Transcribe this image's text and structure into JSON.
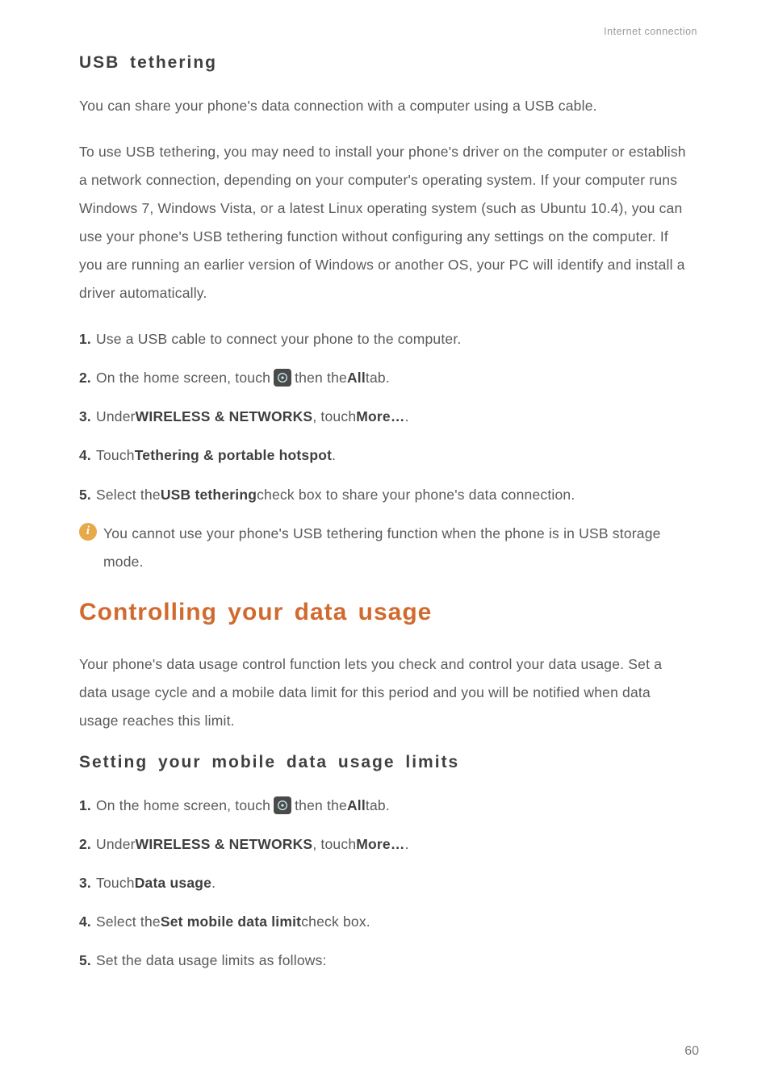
{
  "header": {
    "section_label": "Internet connection"
  },
  "usb_tethering": {
    "title": "USB tethering",
    "intro": "You can share your phone's data connection with a computer using a USB cable.",
    "note": "To use USB tethering, you may need to install your phone's driver on the computer or establish a network connection, depending on your computer's operating system. If your computer runs Windows 7, Windows Vista, or a latest Linux operating system (such as Ubuntu 10.4), you can use your phone's USB tethering function without configuring any settings on the computer. If you are running an earlier version of Windows or another OS, your PC will identify and install a driver automatically.",
    "steps": {
      "s1": {
        "num": "1.",
        "text": "Use a USB cable to connect your phone to the computer."
      },
      "s2": {
        "num": "2.",
        "pre": "On the home screen, touch ",
        "post1": " then the ",
        "bold": "All",
        "post2": " tab."
      },
      "s3": {
        "num": "3.",
        "pre": "Under ",
        "bold1": "WIRELESS & NETWORKS",
        "mid": ", touch ",
        "bold2": "More…",
        "post": "."
      },
      "s4": {
        "num": "4.",
        "pre": "Touch ",
        "bold": "Tethering & portable hotspot",
        "post": "."
      },
      "s5": {
        "num": "5.",
        "pre": "Select the ",
        "bold": "USB tethering",
        "post": " check box to share your phone's data connection."
      }
    },
    "info": "You cannot use your phone's USB tethering function when the phone is in USB storage mode."
  },
  "data_usage": {
    "title": "Controlling your data usage",
    "intro": "Your phone's data usage control function lets you check and control your data usage. Set a data usage cycle and a mobile data limit for this period and you will be notified when data usage reaches this limit.",
    "subtitle": "Setting your mobile data usage limits",
    "steps": {
      "s1": {
        "num": "1.",
        "pre": "On the home screen, touch ",
        "post1": " then the ",
        "bold": "All",
        "post2": " tab."
      },
      "s2": {
        "num": "2.",
        "pre": "Under ",
        "bold1": "WIRELESS & NETWORKS",
        "mid": ", touch ",
        "bold2": "More…",
        "post": "."
      },
      "s3": {
        "num": "3.",
        "pre": "Touch ",
        "bold": "Data usage",
        "post": "."
      },
      "s4": {
        "num": "4.",
        "pre": "Select the ",
        "bold": "Set mobile data limit",
        "post": " check box."
      },
      "s5": {
        "num": "5.",
        "text": "Set the data usage limits as follows:"
      }
    }
  },
  "page_number": "60",
  "icons": {
    "settings": "settings-icon",
    "info": "info-icon"
  }
}
